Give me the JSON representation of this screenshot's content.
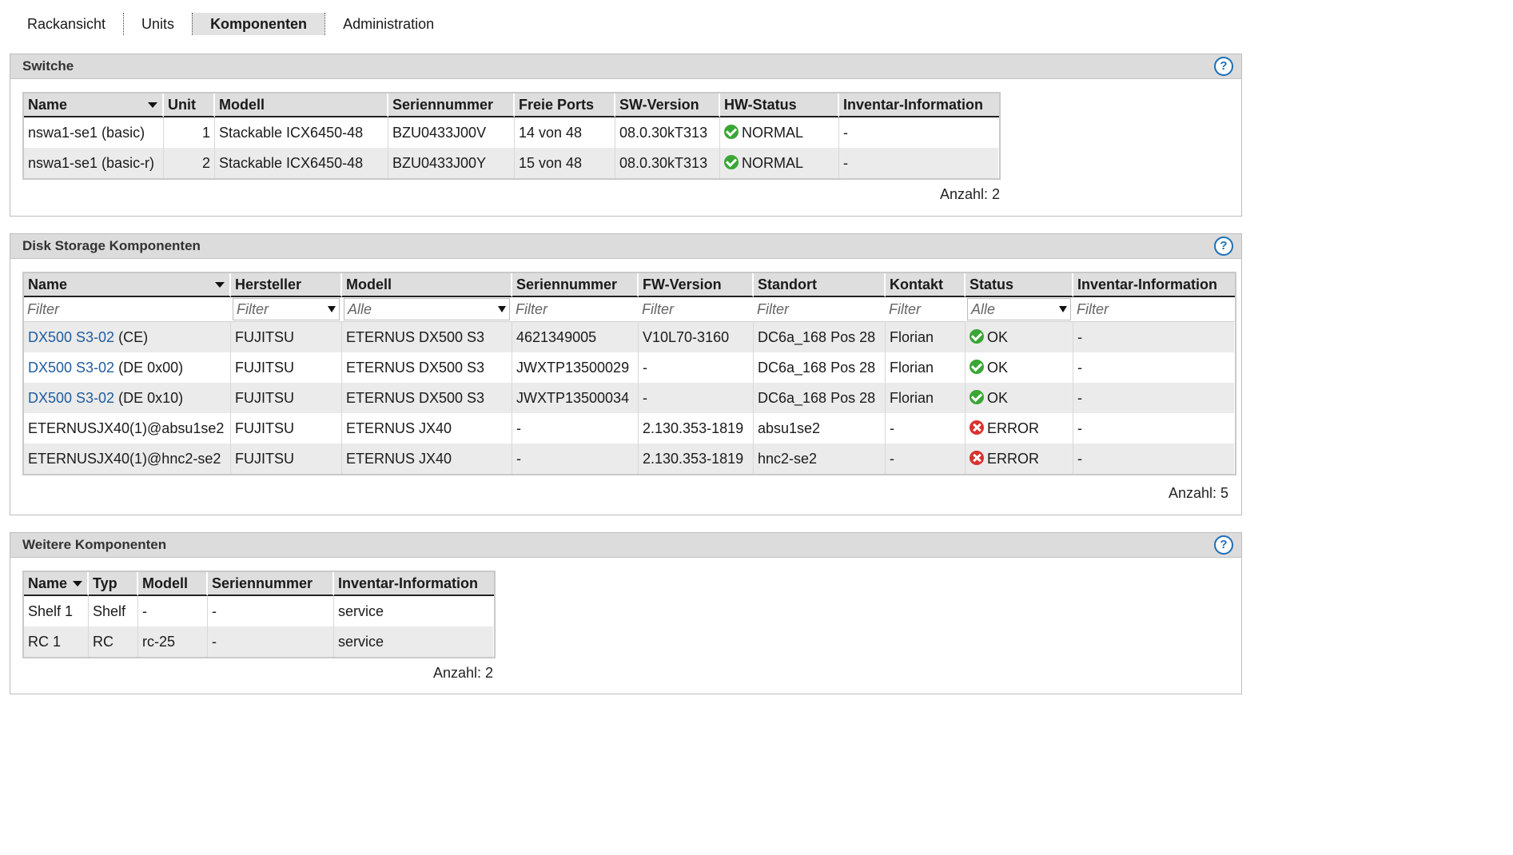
{
  "tabs": [
    "Rackansicht",
    "Units",
    "Komponenten",
    "Administration"
  ],
  "active_tab": "Komponenten",
  "help_glyph": "?",
  "switches": {
    "title": "Switche",
    "headers": [
      "Name",
      "Unit",
      "Modell",
      "Seriennummer",
      "Freie Ports",
      "SW-Version",
      "HW-Status",
      "Inventar-Information"
    ],
    "rows": [
      {
        "name": "nswa1-se1 (basic)",
        "unit": "1",
        "model": "Stackable ICX6450-48",
        "serial": "BZU0433J00V",
        "ports": "14 von 48",
        "sw": "08.0.30kT313",
        "status": "NORMAL",
        "status_icon": "ok-icon",
        "inventory": "-"
      },
      {
        "name": "nswa1-se1 (basic-r)",
        "unit": "2",
        "model": "Stackable ICX6450-48",
        "serial": "BZU0433J00Y",
        "ports": "15 von 48",
        "sw": "08.0.30kT313",
        "status": "NORMAL",
        "status_icon": "ok-icon",
        "inventory": "-"
      }
    ],
    "count": "Anzahl: 2"
  },
  "disk": {
    "title": "Disk Storage Komponenten",
    "headers": [
      "Name",
      "Hersteller",
      "Modell",
      "Seriennummer",
      "FW-Version",
      "Standort",
      "Kontakt",
      "Status",
      "Inventar-Information"
    ],
    "filters": {
      "name": "Filter",
      "vendor": "Filter",
      "model": "Alle",
      "serial": "Filter",
      "fw": "Filter",
      "location": "Filter",
      "contact": "Filter",
      "status": "Alle",
      "inventory": "Filter"
    },
    "rows": [
      {
        "name_link": "DX500 S3-02",
        "name_suffix": " (CE)",
        "vendor": "FUJITSU",
        "model": "ETERNUS DX500 S3",
        "serial": "4621349005",
        "fw": "V10L70-3160",
        "location": "DC6a_168 Pos 28",
        "contact": "Florian",
        "status": "OK",
        "status_icon": "ok-icon",
        "inventory": "-"
      },
      {
        "name_link": "DX500 S3-02",
        "name_suffix": " (DE 0x00)",
        "vendor": "FUJITSU",
        "model": "ETERNUS DX500 S3",
        "serial": "JWXTP13500029",
        "fw": "-",
        "location": "DC6a_168 Pos 28",
        "contact": "Florian",
        "status": "OK",
        "status_icon": "ok-icon",
        "inventory": "-"
      },
      {
        "name_link": "DX500 S3-02",
        "name_suffix": " (DE 0x10)",
        "vendor": "FUJITSU",
        "model": "ETERNUS DX500 S3",
        "serial": "JWXTP13500034",
        "fw": "-",
        "location": "DC6a_168 Pos 28",
        "contact": "Florian",
        "status": "OK",
        "status_icon": "ok-icon",
        "inventory": "-"
      },
      {
        "name_link": "",
        "name_suffix": "ETERNUSJX40(1)@absu1se2",
        "vendor": "FUJITSU",
        "model": "ETERNUS JX40",
        "serial": "-",
        "fw": "2.130.353-1819",
        "location": "absu1se2",
        "contact": "-",
        "status": "ERROR",
        "status_icon": "error-icon",
        "inventory": "-"
      },
      {
        "name_link": "",
        "name_suffix": "ETERNUSJX40(1)@hnc2-se2",
        "vendor": "FUJITSU",
        "model": "ETERNUS JX40",
        "serial": "-",
        "fw": "2.130.353-1819",
        "location": "hnc2-se2",
        "contact": "-",
        "status": "ERROR",
        "status_icon": "error-icon",
        "inventory": "-"
      }
    ],
    "count": "Anzahl: 5"
  },
  "other": {
    "title": "Weitere Komponenten",
    "headers": [
      "Name",
      "Typ",
      "Modell",
      "Seriennummer",
      "Inventar-Information"
    ],
    "rows": [
      {
        "name": "Shelf 1",
        "type": "Shelf",
        "model": "-",
        "serial": "-",
        "inventory": "service"
      },
      {
        "name": "RC 1",
        "type": "RC",
        "model": "rc-25",
        "serial": "-",
        "inventory": "service"
      }
    ],
    "count": "Anzahl: 2"
  }
}
